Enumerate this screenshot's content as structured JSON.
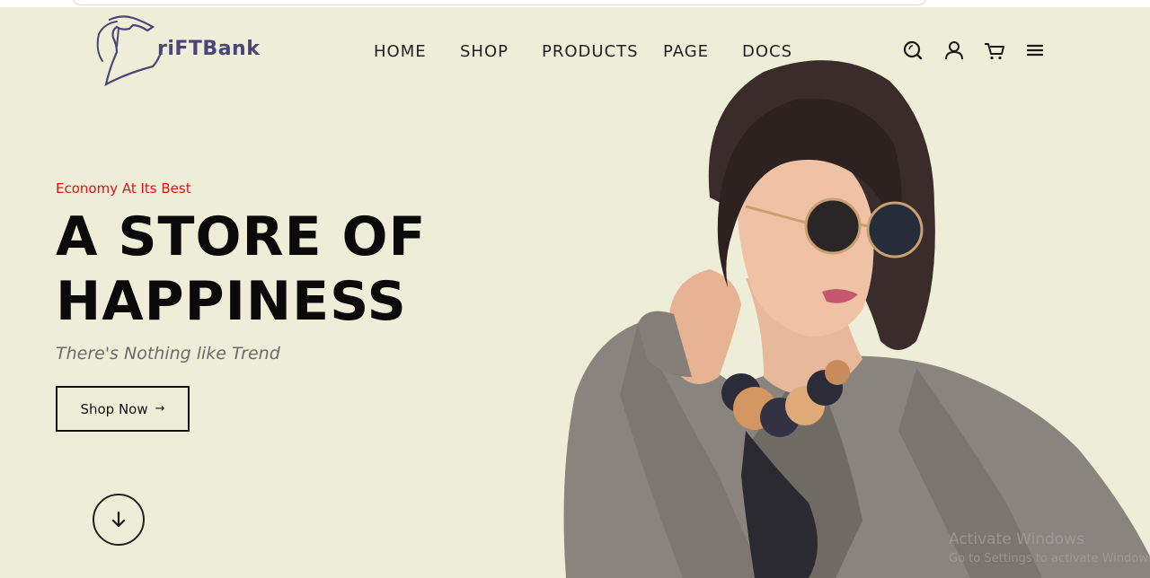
{
  "logo": {
    "text": "riFTBank"
  },
  "nav": {
    "items": [
      "HOME",
      "SHOP",
      "PRODUCTS",
      "PAGE",
      "DOCS"
    ]
  },
  "header_icons": [
    "search-icon",
    "user-icon",
    "cart-icon",
    "menu-icon"
  ],
  "hero": {
    "tagline": "Economy At Its Best",
    "title_line1": "A STORE OF",
    "title_line2": "HAPPINESS",
    "subtitle": "There's Nothing like Trend",
    "cta_label": "Shop Now",
    "cta_arrow": "→"
  },
  "watermark": {
    "line1": "Activate Windows",
    "line2": "Go to Settings to activate Windows."
  },
  "colors": {
    "background": "#eeeed8",
    "accent": "#e21212",
    "text": "#0a0a0a",
    "logo": "#4a4578"
  }
}
